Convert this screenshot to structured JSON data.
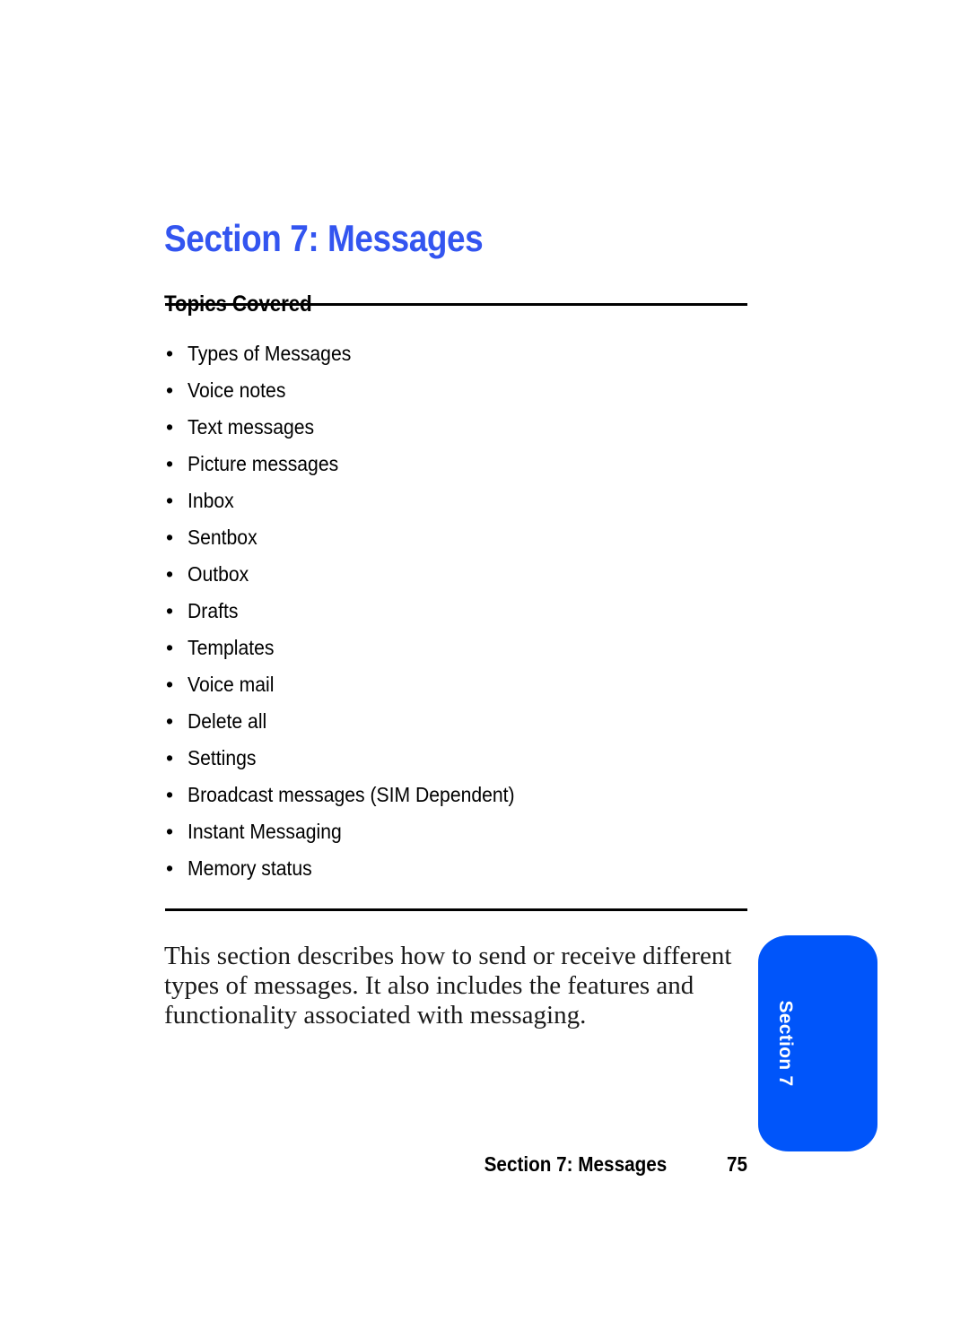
{
  "document": {
    "section_title": "Section 7: Messages",
    "topics_heading": "Topics Covered",
    "topics": [
      {
        "label": "Types of Messages"
      },
      {
        "label": "Voice notes"
      },
      {
        "label": "Text messages"
      },
      {
        "label": "Picture messages"
      },
      {
        "label": "Inbox"
      },
      {
        "label": "Sentbox"
      },
      {
        "label": "Outbox"
      },
      {
        "label": "Drafts"
      },
      {
        "label": "Templates"
      },
      {
        "label": "Voice mail"
      },
      {
        "label": "Delete all"
      },
      {
        "label": "Settings"
      },
      {
        "label": "Broadcast messages (SIM Dependent)"
      },
      {
        "label": "Instant Messaging"
      },
      {
        "label": "Memory status"
      }
    ],
    "bullet_glyph": "•",
    "intro_paragraph": "This section describes how to send or receive different types of messages. It also includes the features and functionality associated with messaging.",
    "side_tab": {
      "label": "Section 7"
    },
    "footer": {
      "title": "Section 7: Messages",
      "page_number": "75"
    },
    "colors": {
      "title_blue": "#3355f0",
      "tab_blue": "#0055fa",
      "rule_black": "#000000",
      "body_text": "#1a1a1a",
      "page_background": "#ffffff"
    }
  }
}
